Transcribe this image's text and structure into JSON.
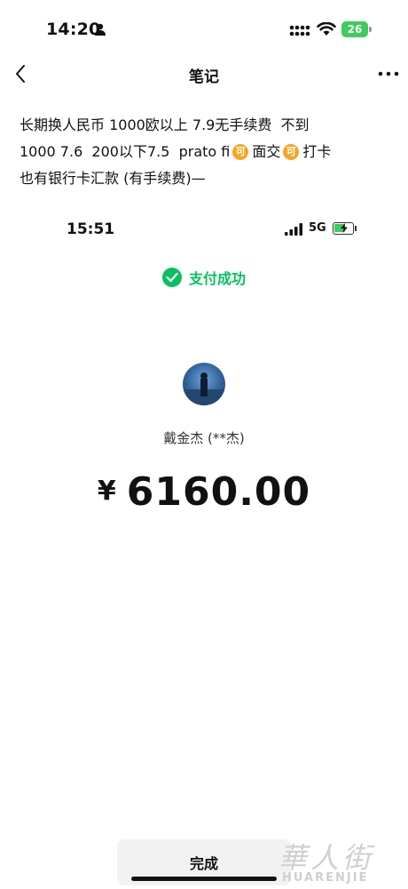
{
  "status_bar": {
    "time": "14:20",
    "battery": "26"
  },
  "nav": {
    "title": "笔记"
  },
  "note": {
    "line1": "长期换人民币 1000欧以上 7.9无手续费  不到",
    "line2_a": "1000 7.6  200以下7.5  prato fi",
    "line2_b": "面交",
    "line2_c": "打卡",
    "line3": "也有银行卡汇款 (有手续费)—",
    "emoji_glyph": "可"
  },
  "embedded": {
    "time": "15:51",
    "network": "5G",
    "status_text": "支付成功",
    "payee_name": "戴金杰 (**杰)",
    "currency": "¥",
    "amount": "6160.00"
  },
  "footer": {
    "done_label": "完成"
  },
  "watermark": {
    "script": "華人街",
    "latin": "HUARENJIE"
  },
  "colors": {
    "wechat_green": "#07c160",
    "battery_green": "#3ecb5f",
    "emoji_orange": "#f5a623"
  },
  "icons": [
    "person-icon",
    "cell-signal-icon",
    "wifi-icon",
    "battery-icon",
    "back-icon",
    "more-icon",
    "wechat-pay-check-icon",
    "avatar"
  ]
}
